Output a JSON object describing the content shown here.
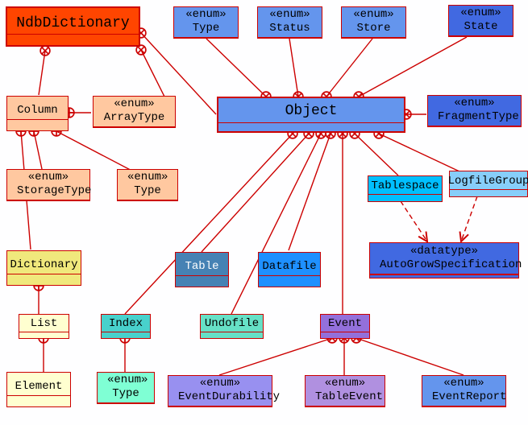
{
  "diagram": {
    "stereotype_enum": "«enum»",
    "stereotype_datatype": "«datatype»",
    "ndbdictionary": "NdbDictionary",
    "type1": "Type",
    "status": "Status",
    "store": "Store",
    "state": "State",
    "column": "Column",
    "arraytype": "ArrayType",
    "object": "Object",
    "fragmenttype": "FragmentType",
    "storagetype": "StorageType",
    "type2": "Type",
    "tablespace": "Tablespace",
    "logfilegroup": "LogfileGroup",
    "dictionary": "Dictionary",
    "table": "Table",
    "datafile": "Datafile",
    "autogrow": "AutoGrowSpecification",
    "list": "List",
    "index": "Index",
    "undofile": "Undofile",
    "event": "Event",
    "element": "Element",
    "type3": "Type",
    "eventdurability": "EventDurability",
    "tableevent": "TableEvent",
    "eventreport": "EventReport"
  }
}
